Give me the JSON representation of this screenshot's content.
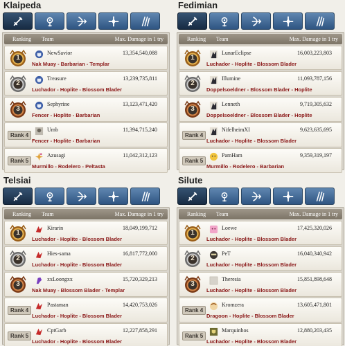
{
  "header_labels": {
    "ranking": "Ranking",
    "team": "Team",
    "damage": "Max. Damage in 1 try"
  },
  "tab_icons": [
    "swordsman-icon",
    "wizard-icon",
    "archer-icon",
    "cleric-icon",
    "scout-icon"
  ],
  "colors": {
    "tab_blue": "#3f6a99",
    "tab_active": "#1f3652",
    "class_text": "#8a1717",
    "gold": "#c68a2e",
    "silver": "#8d8d8d",
    "bronze": "#b0612f"
  },
  "servers": [
    {
      "name": "Klaipeda",
      "rows": [
        {
          "rank": "1",
          "medal": "gold",
          "avatar": "blue-crest-avatar",
          "team": "NewSavior",
          "damage": "13,354,540,088",
          "classes": "Nak Muay - Barbarian - Templar"
        },
        {
          "rank": "2",
          "medal": "silver",
          "avatar": "blue-crest-avatar",
          "team": "Treasure",
          "damage": "13,239,735,811",
          "classes": "Luchador - Hoplite - Blossom Blader"
        },
        {
          "rank": "3",
          "medal": "bronze",
          "avatar": "blue-crest-avatar",
          "team": "Sephyrine",
          "damage": "13,123,471,420",
          "classes": "Fencer - Hoplite - Barbarian"
        },
        {
          "rank": "Rank 4",
          "medal": "",
          "avatar": "grey-portrait-avatar",
          "team": "Umb",
          "damage": "11,394,715,240",
          "classes": "Fencer - Hoplite - Barbarian"
        },
        {
          "rank": "Rank 5",
          "medal": "",
          "avatar": "sparkle-avatar",
          "team": "Azusagi",
          "damage": "11,042,312,123",
          "classes": "Murmillo - Rodelero - Peltasta"
        }
      ]
    },
    {
      "name": "Fedimian",
      "rows": [
        {
          "rank": "1",
          "medal": "gold",
          "avatar": "dark-figure-avatar",
          "team": "LunarEclipse",
          "damage": "16,003,223,803",
          "classes": "Luchador - Hoplite - Blossom Blader"
        },
        {
          "rank": "2",
          "medal": "silver",
          "avatar": "dark-figure-avatar",
          "team": "Illumine",
          "damage": "11,093,787,156",
          "classes": "Doppelsoeldner - Blossom Blader - Hoplite"
        },
        {
          "rank": "3",
          "medal": "bronze",
          "avatar": "dark-figure-avatar",
          "team": "Lenneth",
          "damage": "9,719,305,632",
          "classes": "Doppelsoeldner - Blossom Blader - Hoplite"
        },
        {
          "rank": "Rank 4",
          "medal": "",
          "avatar": "dark-figure-avatar",
          "team": "NifelheimXI",
          "damage": "9,623,635,695",
          "classes": "Luchador - Hoplite - Blossom Blader"
        },
        {
          "rank": "Rank 5",
          "medal": "",
          "avatar": "yellow-face-avatar",
          "team": "PamHam",
          "damage": "9,359,319,197",
          "classes": "Murmillo - Rodelero - Barbarian"
        }
      ]
    },
    {
      "name": "Telsiai",
      "rows": [
        {
          "rank": "1",
          "medal": "gold",
          "avatar": "red-bird-avatar",
          "team": "Kirarin",
          "damage": "18,049,199,712",
          "classes": "Luchador - Hoplite - Blossom Blader"
        },
        {
          "rank": "2",
          "medal": "silver",
          "avatar": "red-bird-avatar",
          "team": "Hies-sama",
          "damage": "16,817,772,000",
          "classes": "Luchador - Hoplite - Blossom Blader"
        },
        {
          "rank": "3",
          "medal": "bronze",
          "avatar": "purple-creature-avatar",
          "team": "xxLoongxx",
          "damage": "15,720,329,213",
          "classes": "Nak Muay - Blossom Blader - Templar"
        },
        {
          "rank": "Rank 4",
          "medal": "",
          "avatar": "red-bird-avatar",
          "team": "Pastaman",
          "damage": "14,420,753,026",
          "classes": "Luchador - Hoplite - Blossom Blader"
        },
        {
          "rank": "Rank 5",
          "medal": "",
          "avatar": "red-bird-avatar",
          "team": "CptGarb",
          "damage": "12,227,858,291",
          "classes": "Luchador - Hoplite - Blossom Blader"
        }
      ]
    },
    {
      "name": "Silute",
      "rows": [
        {
          "rank": "1",
          "medal": "gold",
          "avatar": "pink-face-avatar",
          "team": "Loewe",
          "damage": "17,425,320,026",
          "classes": "Luchador - Hoplite - Blossom Blader"
        },
        {
          "rank": "2",
          "medal": "silver",
          "avatar": "dark-mask-avatar",
          "team": "PeT",
          "damage": "16,040,340,942",
          "classes": "Luchador - Hoplite - Blossom Blader"
        },
        {
          "rank": "3",
          "medal": "bronze",
          "avatar": "blank-avatar",
          "team": "Theresia",
          "damage": "15,851,898,648",
          "classes": "Luchador - Hoplite - Blossom Blader"
        },
        {
          "rank": "Rank 4",
          "medal": "",
          "avatar": "pale-face-avatar",
          "team": "Kromzera",
          "damage": "13,605,471,801",
          "classes": "Dragoon - Hoplite - Blossom Blader"
        },
        {
          "rank": "Rank 5",
          "medal": "",
          "avatar": "olive-crest-avatar",
          "team": "Marquinhos",
          "damage": "12,880,203,435",
          "classes": "Luchador - Hoplite - Blossom Blader"
        }
      ]
    }
  ]
}
